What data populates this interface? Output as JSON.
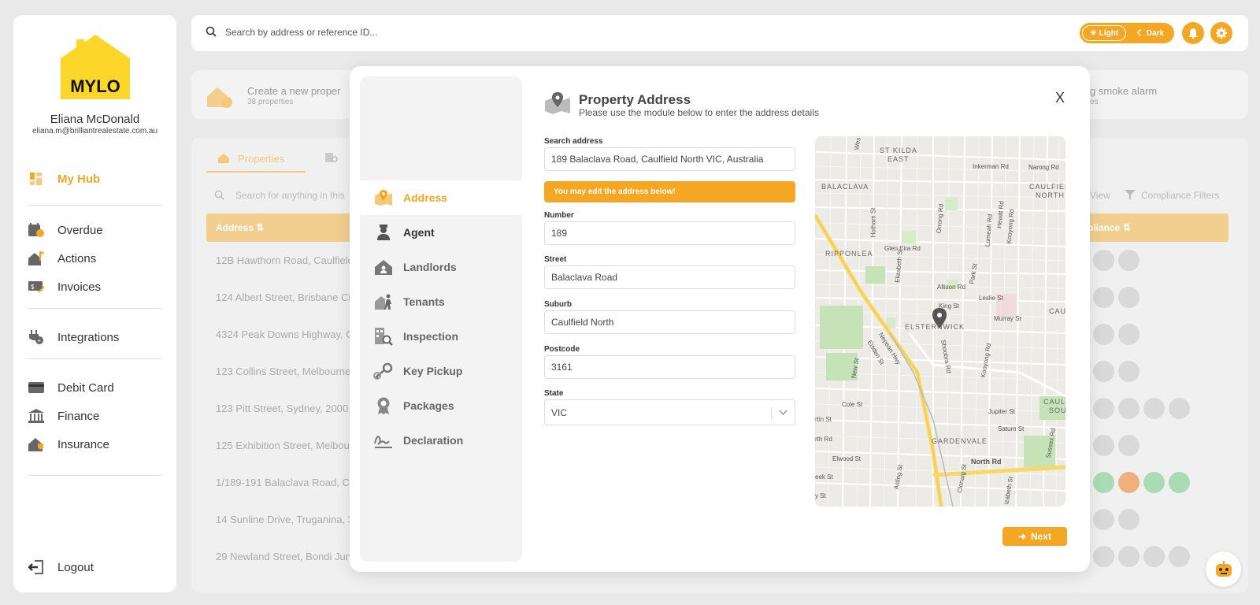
{
  "app": {
    "brand": "MYLO",
    "user_name": "Eliana McDonald",
    "user_email": "eliana.m@brilliantrealestate.com.au"
  },
  "sidebar": {
    "items": [
      {
        "label": "My Hub",
        "icon": "dashboard-icon"
      },
      {
        "label": "Overdue",
        "icon": "calendar-alert-icon"
      },
      {
        "label": "Actions",
        "icon": "house-flag-icon"
      },
      {
        "label": "Invoices",
        "icon": "invoice-icon"
      },
      {
        "label": "Integrations",
        "icon": "plug-icon"
      },
      {
        "label": "Debit Card",
        "icon": "card-icon"
      },
      {
        "label": "Finance",
        "icon": "bank-icon"
      },
      {
        "label": "Insurance",
        "icon": "house-shield-icon"
      }
    ],
    "logout": "Logout"
  },
  "topbar": {
    "search_placeholder": "Search by address or reference ID...",
    "theme_light": "Light",
    "theme_dark": "Dark"
  },
  "background": {
    "card_left_title": "Create a new proper",
    "card_left_sub": "38 properties",
    "card_right_title": "g smoke alarm",
    "card_right_sub": "es",
    "tab_label": "Properties",
    "search_placeholder": "Search for anything in this",
    "view_label": "View",
    "filters_label": "Compliance Filters",
    "col_address": "Address",
    "col_compliance": "pliance",
    "rows": [
      "12B Hawthorn Road, Caulfield",
      "124 Albert Street, Brisbane Cit",
      "4324 Peak Downs Highway, C",
      "123 Collins Street, Melbourne,",
      "123 Pitt Street, Sydney, 2000, I",
      "125 Exhibition Street, Melbour",
      "1/189-191 Balaclava Road, Caul",
      "14 Sunline Drive, Truganina, 3",
      "29 Newland Street, Bondi Jun"
    ]
  },
  "modal": {
    "title": "Property Address",
    "subtitle": "Please use the module below to enter the address details",
    "steps": [
      "Address",
      "Agent",
      "Landlords",
      "Tenants",
      "Inspection",
      "Key Pickup",
      "Packages",
      "Declaration"
    ],
    "search_label": "Search address",
    "search_value": "189 Balaclava Road, Caulfield North VIC, Australia",
    "notice": "You may edit the address below!",
    "number_label": "Number",
    "number_value": "189",
    "street_label": "Street",
    "street_value": "Balaclava Road",
    "suburb_label": "Suburb",
    "suburb_value": "Caulfield North",
    "postcode_label": "Postcode",
    "postcode_value": "3161",
    "state_label": "State",
    "state_value": "VIC",
    "next_label": "Next",
    "close_label": "X"
  },
  "map": {
    "labels": [
      "ST KILDA",
      "EAST",
      "Inkerman Rd",
      "Narong Rd",
      "BALACLAVA",
      "CAULFIELD",
      "NORTH",
      "RIPPONLEA",
      "Glen Eira Rd",
      "Hotham St",
      "Orrong Rd",
      "Lumeah Rd",
      "Hewitt Rd",
      "Kooyong Rd",
      "Elizabeth St",
      "Allison Rd",
      "Park St",
      "Leslie St",
      "King St",
      "Murray St",
      "ELSTERNWICK",
      "Nepean Hwy",
      "Elsden St",
      "Shoobra Rd",
      "Kooyong Rd",
      "New St",
      "Cole St",
      "Jupiter St",
      "Saturn St",
      "GARDENVALE",
      "North Rd",
      "Elwood St",
      "Asling St",
      "Clonaig St",
      "Sussex Rd",
      "CAUL",
      "CAULF",
      "SOU",
      "Wes",
      "rtin St",
      "rth Rd",
      "eek St",
      "y St",
      "izabeth St"
    ]
  },
  "colors": {
    "accent": "#f5a623",
    "header_bg": "#f2cf8f"
  }
}
